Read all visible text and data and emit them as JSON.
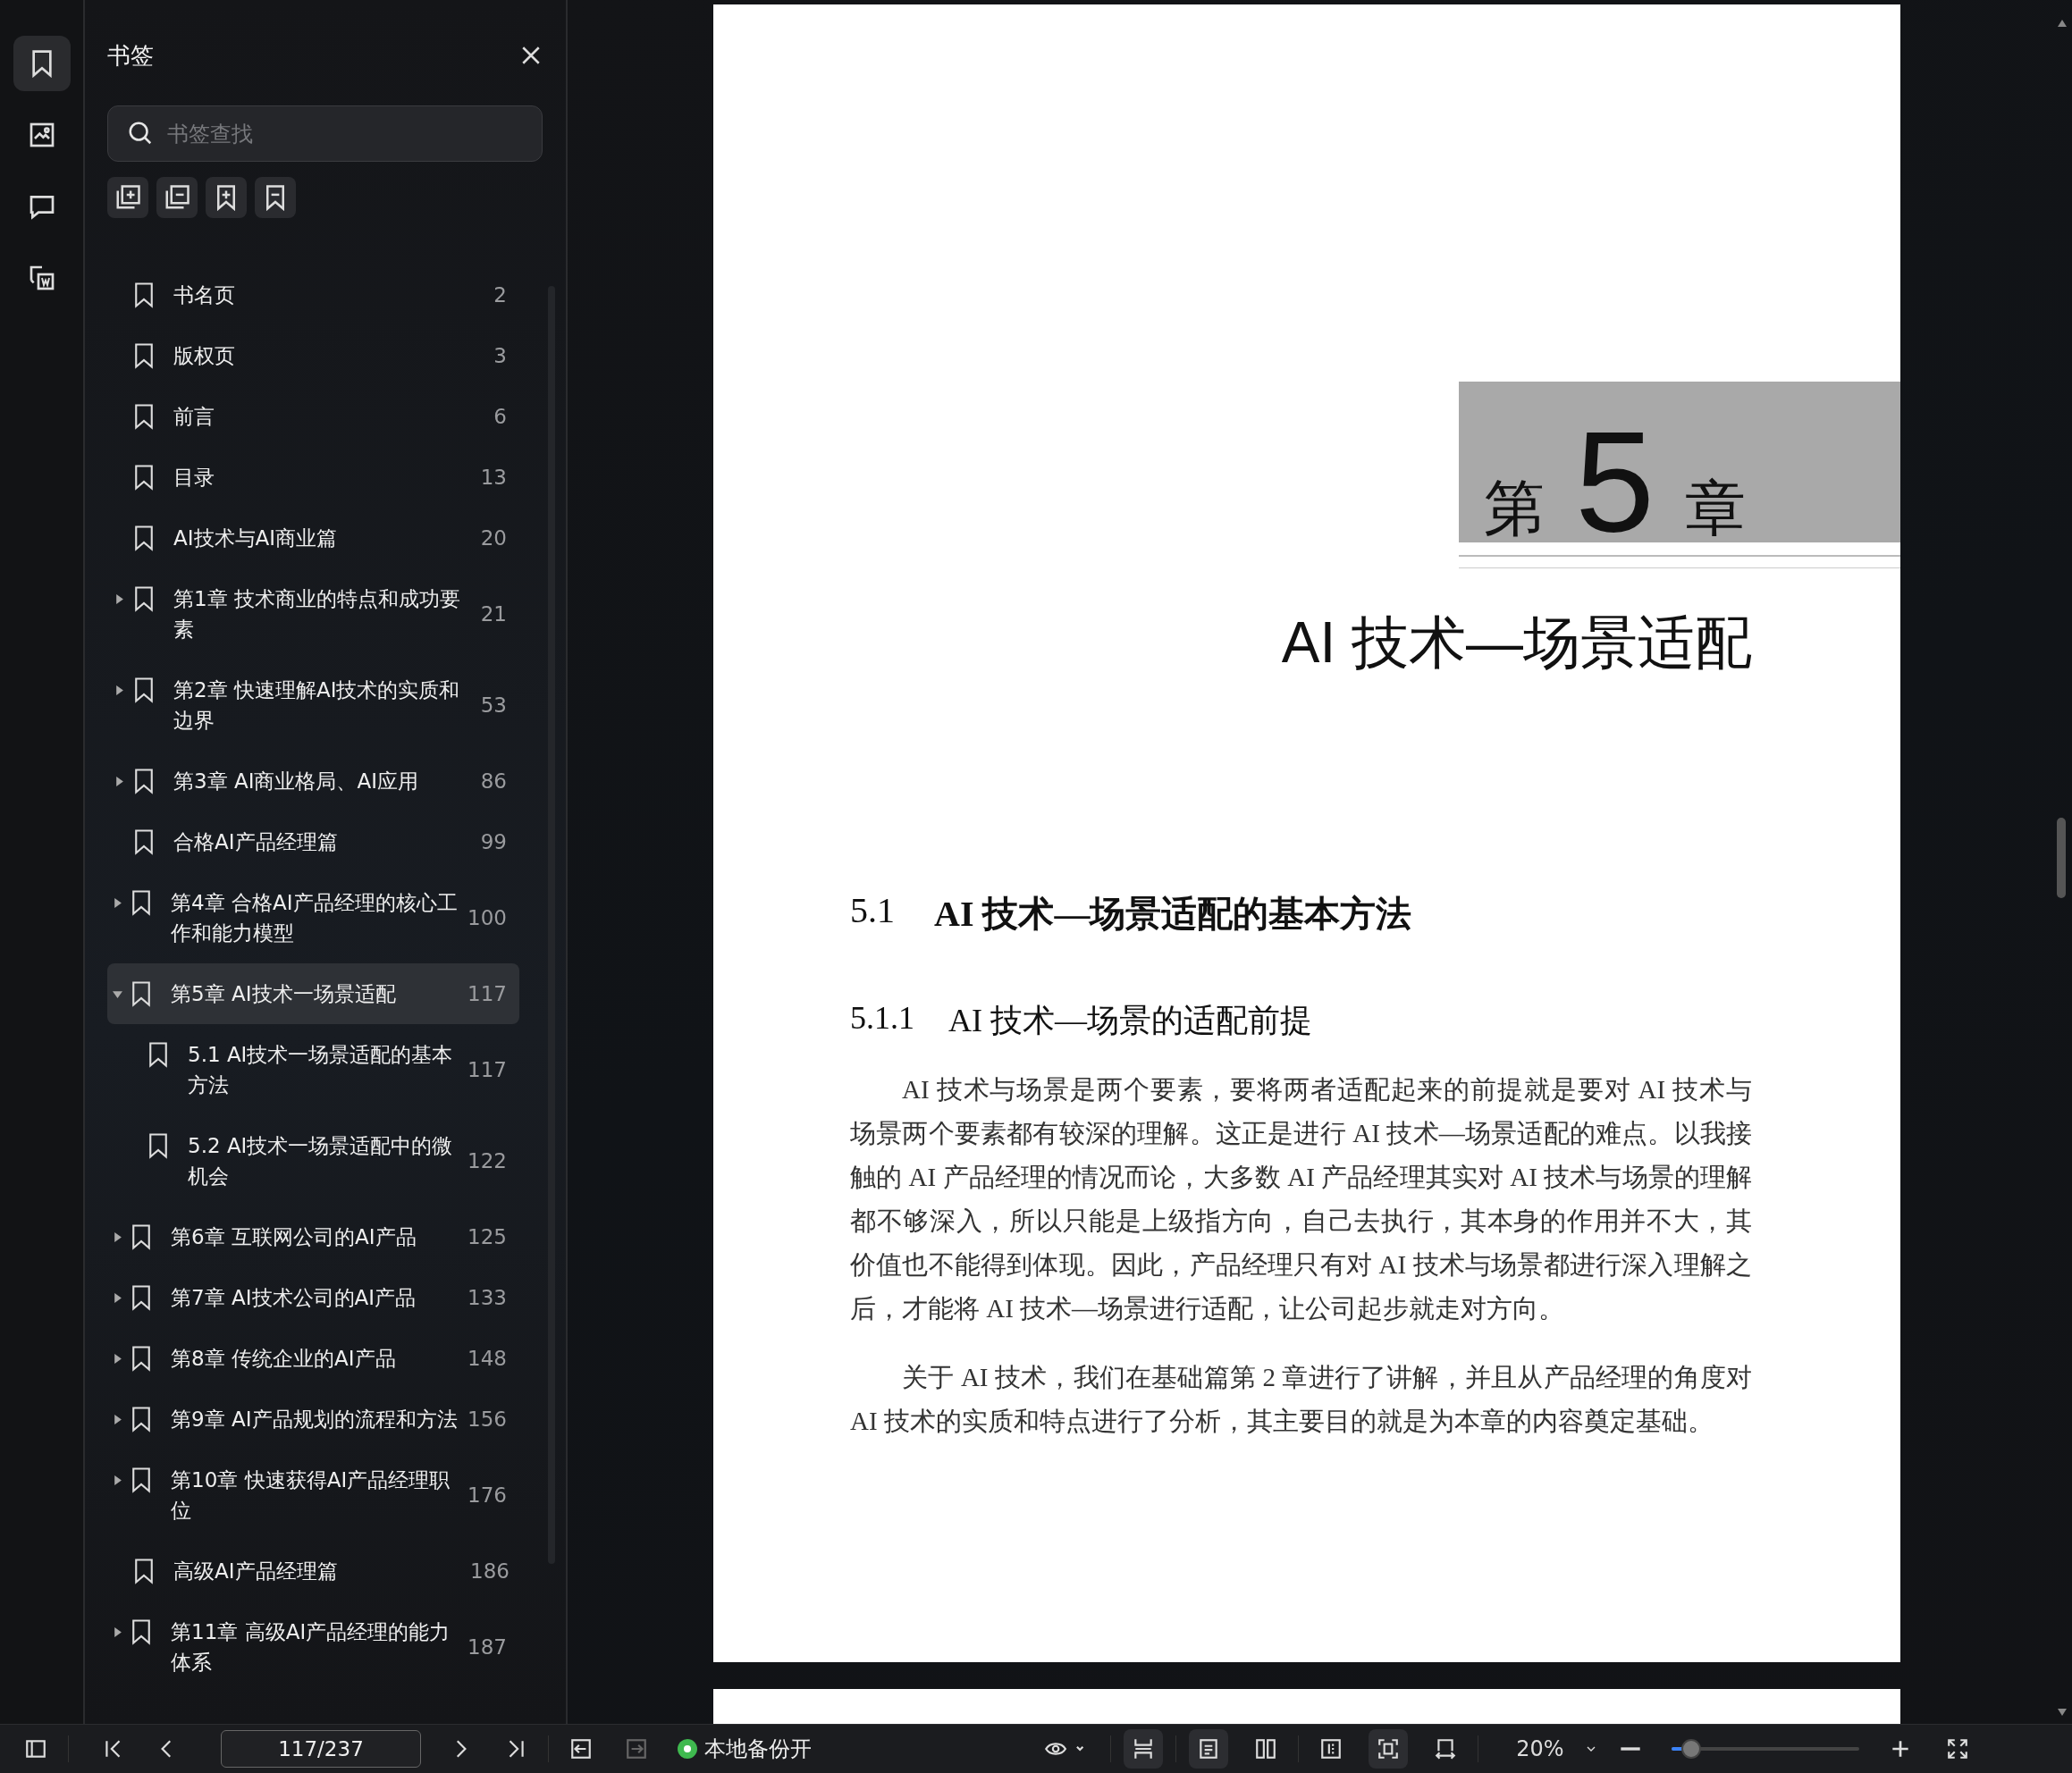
{
  "rail": [
    {
      "kind": "bookmark",
      "selected": true
    },
    {
      "kind": "image",
      "selected": false
    },
    {
      "kind": "comment",
      "selected": false
    },
    {
      "kind": "convert",
      "selected": false
    }
  ],
  "sidebar": {
    "title": "书签",
    "search": {
      "placeholder": "书签查找"
    },
    "tools": [
      {
        "kind": "expand-all"
      },
      {
        "kind": "collapse-all"
      },
      {
        "kind": "add-bookmark"
      },
      {
        "kind": "remove-bookmark"
      }
    ],
    "bookmarks": [
      {
        "title": "书名页",
        "page": "2",
        "selected": false
      },
      {
        "title": "版权页",
        "page": "3",
        "selected": false
      },
      {
        "title": "前言",
        "page": "6",
        "selected": false
      },
      {
        "title": "目录",
        "page": "13",
        "selected": false
      },
      {
        "title": "AI技术与AI商业篇",
        "page": "20",
        "selected": false
      },
      {
        "title": "第1章 技术商业的特点和成功要素",
        "page": "21",
        "kind": "group",
        "expanded": false,
        "selected": false
      },
      {
        "title": "第2章 快速理解AI技术的实质和边界",
        "page": "53",
        "kind": "group",
        "expanded": false,
        "selected": false
      },
      {
        "title": "第3章 AI商业格局、AI应用",
        "page": "86",
        "kind": "group",
        "expanded": false,
        "selected": false
      },
      {
        "title": "合格AI产品经理篇",
        "page": "99",
        "selected": false
      },
      {
        "title": "第4章 合格AI产品经理的核心工作和能力模型",
        "page": "100",
        "kind": "group",
        "expanded": false,
        "selected": false
      },
      {
        "title": "第5章 AI技术一场景适配",
        "page": "117",
        "kind": "group",
        "expanded": true,
        "selected": true,
        "children": [
          {
            "title": "5.1 AI技术一场景适配的基本方法",
            "page": "117",
            "selected": false
          },
          {
            "title": "5.2 AI技术一场景适配中的微机会",
            "page": "122",
            "selected": false
          }
        ]
      },
      {
        "title": "第6章 互联网公司的AI产品",
        "page": "125",
        "kind": "group",
        "expanded": false,
        "selected": false
      },
      {
        "title": "第7章 AI技术公司的AI产品",
        "page": "133",
        "kind": "group",
        "expanded": false,
        "selected": false
      },
      {
        "title": "第8章 传统企业的AI产品",
        "page": "148",
        "kind": "group",
        "expanded": false,
        "selected": false
      },
      {
        "title": "第9章 AI产品规划的流程和方法",
        "page": "156",
        "kind": "group",
        "expanded": false,
        "selected": false
      },
      {
        "title": "第10章 快速获得AI产品经理职位",
        "page": "176",
        "kind": "group",
        "expanded": false,
        "selected": false
      },
      {
        "title": "高级AI产品经理篇",
        "page": "186",
        "selected": false
      },
      {
        "title": "第11章 高级AI产品经理的能力体系",
        "page": "187",
        "kind": "group",
        "expanded": false,
        "selected": false
      }
    ]
  },
  "document": {
    "chapter_prefix": "第",
    "chapter_number": "5",
    "chapter_suffix": "章",
    "chapter_title": "AI 技术—场景适配",
    "section_heading": {
      "number": "5.1",
      "title": "AI 技术—场景适配的基本方法"
    },
    "subsection_heading": {
      "number": "5.1.1",
      "title": "AI 技术—场景的适配前提"
    },
    "paragraphs": [
      "AI 技术与场景是两个要素，要将两者适配起来的前提就是要对 AI 技术与场景两个要素都有较深的理解。这正是进行 AI 技术—场景适配的难点。以我接触的 AI 产品经理的情况而论，大多数 AI 产品经理其实对 AI 技术与场景的理解都不够深入，所以只能是上级指方向，自己去执行，其本身的作用并不大，其价值也不能得到体现。因此，产品经理只有对 AI 技术与场景都进行深入理解之后，才能将 AI 技术—场景进行适配，让公司起步就走对方向。",
      "关于 AI 技术，我们在基础篇第 2 章进行了讲解，并且从产品经理的角度对 AI 技术的实质和特点进行了分析，其主要目的就是为本章的内容奠定基础。"
    ]
  },
  "toolbar": {
    "nav": [
      {
        "kind": "first",
        "disabled": false
      },
      {
        "kind": "prev",
        "disabled": false
      }
    ],
    "page_field": "117/237",
    "nav_after": [
      {
        "kind": "next",
        "disabled": false
      },
      {
        "kind": "last",
        "disabled": false
      },
      {
        "kind": "back",
        "disabled": false
      },
      {
        "kind": "forward",
        "disabled": true
      }
    ],
    "backup": {
      "label": "本地备份开",
      "on": true
    },
    "view_buttons": [
      {
        "kind": "continuous",
        "selected": true
      },
      {
        "kind": "single",
        "selected": true
      },
      {
        "kind": "double",
        "selected": false
      },
      {
        "kind": "fit-height",
        "selected": false
      },
      {
        "kind": "fit-page",
        "selected": true
      },
      {
        "kind": "fit-width",
        "selected": false
      }
    ],
    "zoom": {
      "value": "20%",
      "level": 0.1
    }
  }
}
